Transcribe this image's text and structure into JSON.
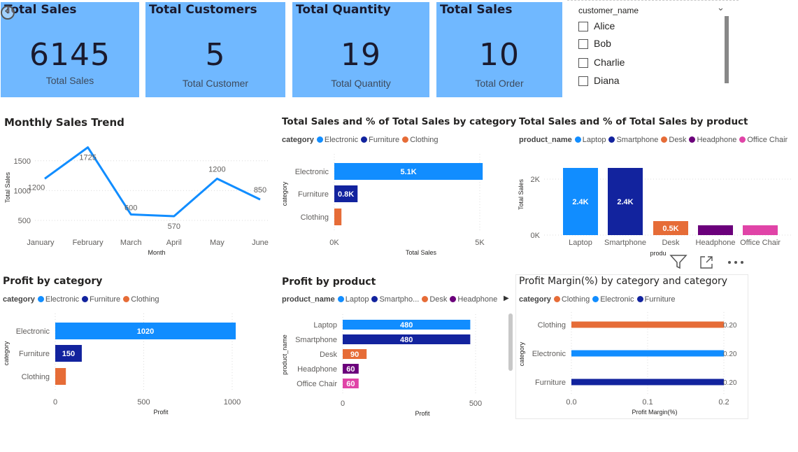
{
  "cards": [
    {
      "title": "Total Sales",
      "value": "6145",
      "label": "Total Sales"
    },
    {
      "title": "Total Customers",
      "value": "5",
      "label": "Total Customer"
    },
    {
      "title": "Total Quantity",
      "value": "19",
      "label": "Total Quantity"
    },
    {
      "title": "Total Sales",
      "value": "10",
      "label": "Total Order"
    }
  ],
  "slicer": {
    "header": "customer_name",
    "items": [
      "Alice",
      "Bob",
      "Charlie",
      "Diana"
    ]
  },
  "colors": {
    "card_bg": "#70b8ff",
    "electronic": "#118dff",
    "furniture": "#12239e",
    "clothing": "#e66c37",
    "headphone": "#6b007b",
    "office_chair": "#e044a7",
    "line": "#118dff"
  },
  "charts": [
    {
      "id": "monthly",
      "title": "Monthly Sales Trend",
      "type": "line",
      "categories": [
        "January",
        "February",
        "March",
        "April",
        "May",
        "June"
      ],
      "values": [
        1200,
        1725,
        600,
        570,
        1200,
        850
      ],
      "data_labels": [
        "1200",
        "1725",
        "600",
        "570",
        "1200",
        "850"
      ],
      "xlabel": "Month",
      "ylabel": "Total Sales",
      "y_ticks": [
        "500",
        "1000",
        "1500"
      ],
      "ylim": [
        300,
        1850
      ]
    },
    {
      "id": "sales_cat",
      "title": "Total Sales and % of Total Sales by category",
      "type": "bar",
      "legend_title": "category",
      "legend": [
        {
          "name": "Electronic",
          "color": "#118dff"
        },
        {
          "name": "Furniture",
          "color": "#12239e"
        },
        {
          "name": "Clothing",
          "color": "#e66c37"
        }
      ],
      "categories": [
        "Electronic",
        "Furniture",
        "Clothing"
      ],
      "values": [
        5100,
        800,
        245
      ],
      "data_labels": [
        "5.1K",
        "0.8K",
        ""
      ],
      "xlabel": "Total Sales",
      "ylabel": "category",
      "x_ticks": [
        "0K",
        "5K"
      ],
      "xlim": [
        0,
        5000
      ]
    },
    {
      "id": "sales_prod",
      "title": "Total Sales and % of Total Sales by product",
      "type": "column",
      "legend_title": "product_name",
      "legend": [
        {
          "name": "Laptop",
          "color": "#118dff"
        },
        {
          "name": "Smartphone",
          "color": "#12239e"
        },
        {
          "name": "Desk",
          "color": "#e66c37"
        },
        {
          "name": "Headphone",
          "color": "#6b007b"
        },
        {
          "name": "Office Chair",
          "color": "#e044a7"
        }
      ],
      "categories": [
        "Laptop",
        "Smartphone",
        "Desk",
        "Headphone",
        "Office Chair"
      ],
      "values": [
        2400,
        2400,
        500,
        350,
        350
      ],
      "data_labels": [
        "2.4K",
        "2.4K",
        "0.5K",
        "",
        ""
      ],
      "xlabel": "produ",
      "ylabel": "Total Sales",
      "y_ticks": [
        "0K",
        "2K"
      ],
      "ylim": [
        0,
        2600
      ]
    },
    {
      "id": "profit_cat",
      "title": "Profit by category",
      "type": "bar",
      "legend_title": "category",
      "legend": [
        {
          "name": "Electronic",
          "color": "#118dff"
        },
        {
          "name": "Furniture",
          "color": "#12239e"
        },
        {
          "name": "Clothing",
          "color": "#e66c37"
        }
      ],
      "categories": [
        "Electronic",
        "Furniture",
        "Clothing"
      ],
      "values": [
        1020,
        150,
        60
      ],
      "data_labels": [
        "1020",
        "150",
        ""
      ],
      "xlabel": "Profit",
      "ylabel": "category",
      "x_ticks": [
        "0",
        "500",
        "1000"
      ],
      "xlim": [
        0,
        1000
      ]
    },
    {
      "id": "profit_prod",
      "title": "Profit by product",
      "type": "bar",
      "legend_title": "product_name",
      "legend": [
        {
          "name": "Laptop",
          "color": "#118dff"
        },
        {
          "name": "Smartpho...",
          "color": "#12239e"
        },
        {
          "name": "Desk",
          "color": "#e66c37"
        },
        {
          "name": "Headphone",
          "color": "#6b007b"
        }
      ],
      "categories": [
        "Laptop",
        "Smartphone",
        "Desk",
        "Headphone",
        "Office Chair"
      ],
      "values": [
        480,
        480,
        90,
        60,
        60
      ],
      "data_labels": [
        "480",
        "480",
        "90",
        "60",
        "60"
      ],
      "xlabel": "Profit",
      "ylabel": "product_name",
      "x_ticks": [
        "0",
        "500"
      ],
      "xlim": [
        0,
        500
      ]
    },
    {
      "id": "margin",
      "title": "Profit Margin(%) by category and category",
      "type": "bar",
      "legend_title": "category",
      "legend": [
        {
          "name": "Clothing",
          "color": "#e66c37"
        },
        {
          "name": "Electronic",
          "color": "#118dff"
        },
        {
          "name": "Furniture",
          "color": "#12239e"
        }
      ],
      "categories": [
        "Clothing",
        "Electronic",
        "Furniture"
      ],
      "values": [
        0.2,
        0.2,
        0.2
      ],
      "data_labels": [
        "0.20",
        "0.20",
        "0.20"
      ],
      "xlabel": "Profit Margin(%)",
      "ylabel": "category",
      "x_ticks": [
        "0.0",
        "0.1",
        "0.2"
      ],
      "xlim": [
        0,
        0.2
      ]
    }
  ],
  "chart_data": [
    {
      "type": "line",
      "title": "Monthly Sales Trend",
      "categories": [
        "January",
        "February",
        "March",
        "April",
        "May",
        "June"
      ],
      "values": [
        1200,
        1725,
        600,
        570,
        1200,
        850
      ],
      "xlabel": "Month",
      "ylabel": "Total Sales"
    },
    {
      "type": "bar",
      "title": "Total Sales and % of Total Sales by category",
      "categories": [
        "Electronic",
        "Furniture",
        "Clothing"
      ],
      "values": [
        5100,
        800,
        245
      ],
      "xlabel": "Total Sales",
      "ylabel": "category"
    },
    {
      "type": "bar",
      "title": "Total Sales and % of Total Sales by product",
      "categories": [
        "Laptop",
        "Smartphone",
        "Desk",
        "Headphone",
        "Office Chair"
      ],
      "values": [
        2400,
        2400,
        500,
        350,
        350
      ],
      "ylabel": "Total Sales"
    },
    {
      "type": "bar",
      "title": "Profit by category",
      "categories": [
        "Electronic",
        "Furniture",
        "Clothing"
      ],
      "values": [
        1020,
        150,
        60
      ],
      "xlabel": "Profit",
      "ylabel": "category"
    },
    {
      "type": "bar",
      "title": "Profit by product",
      "categories": [
        "Laptop",
        "Smartphone",
        "Desk",
        "Headphone",
        "Office Chair"
      ],
      "values": [
        480,
        480,
        90,
        60,
        60
      ],
      "xlabel": "Profit",
      "ylabel": "product_name"
    },
    {
      "type": "bar",
      "title": "Profit Margin(%) by category and category",
      "categories": [
        "Clothing",
        "Electronic",
        "Furniture"
      ],
      "values": [
        0.2,
        0.2,
        0.2
      ],
      "xlabel": "Profit Margin(%)",
      "ylabel": "category"
    }
  ]
}
